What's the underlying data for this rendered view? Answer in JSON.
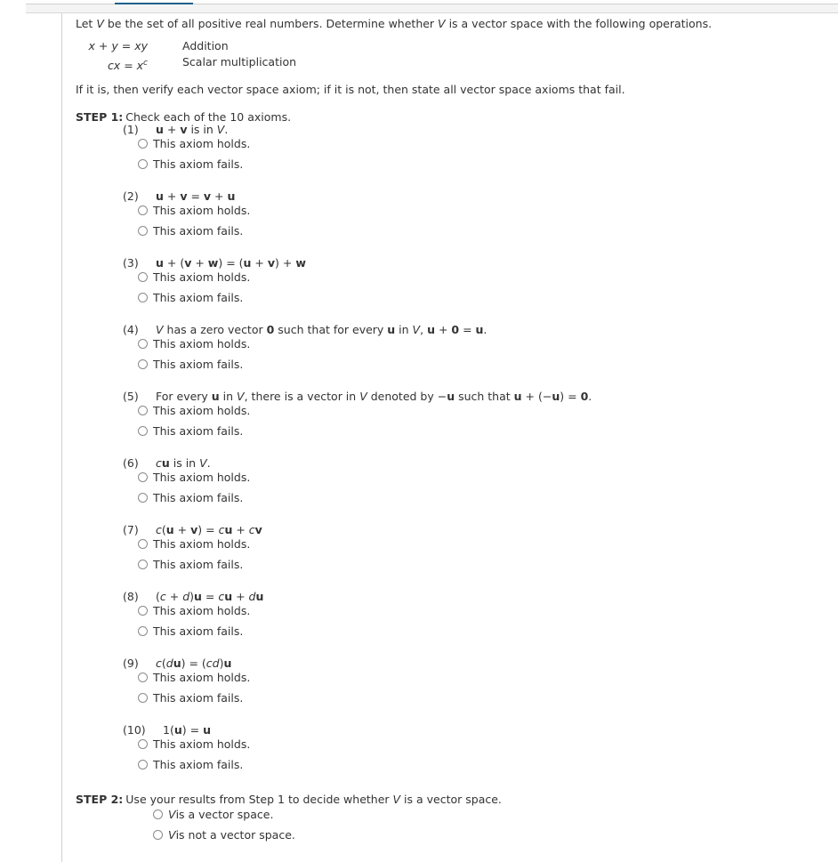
{
  "problem": {
    "intro_parts": [
      "Let ",
      "V",
      " be the set of all positive real numbers. Determine whether ",
      "V",
      " is a vector space with the following operations."
    ],
    "operations": [
      {
        "lhs_a": "x",
        "op": " + ",
        "lhs_b": "y",
        "eq": " = ",
        "rhs": "xy",
        "label": "Addition"
      },
      {
        "lhs_a": "cx",
        "eq": " = ",
        "rhs_base": "x",
        "rhs_sup": "c",
        "label": "Scalar multiplication"
      }
    ],
    "instruction": "If it is, then verify each vector space axiom; if it is not, then state all vector space axioms that fail."
  },
  "step1": {
    "label": "STEP 1:",
    "text": "Check each of the 10 axioms.",
    "axioms": [
      {
        "num": "(1)",
        "statement_html": "<b>u</b> + <b>v</b> is in <i>V</i>."
      },
      {
        "num": "(2)",
        "statement_html": "<b>u</b> + <b>v</b> = <b>v</b> + <b>u</b>"
      },
      {
        "num": "(3)",
        "statement_html": "<b>u</b> + (<b>v</b> + <b>w</b>) = (<b>u</b> + <b>v</b>) + <b>w</b>"
      },
      {
        "num": "(4)",
        "statement_html": "<i>V</i> has a zero vector <b>0</b> such that for every <b>u</b> in <i>V</i>, <b>u</b> + <b>0</b> = <b>u</b>."
      },
      {
        "num": "(5)",
        "statement_html": "For every <b>u</b> in <i>V</i>, there is a vector in <i>V</i> denoted by &minus;<b>u</b> such that <b>u</b> + (&minus;<b>u</b>) = <b>0</b>."
      },
      {
        "num": "(6)",
        "statement_html": "<i>c</i><b>u</b> is in <i>V</i>."
      },
      {
        "num": "(7)",
        "statement_html": "<i>c</i>(<b>u</b> + <b>v</b>) = <i>c</i><b>u</b> + <i>c</i><b>v</b>"
      },
      {
        "num": "(8)",
        "statement_html": "(<i>c</i> + <i>d</i>)<b>u</b> = <i>c</i><b>u</b> + <i>d</i><b>u</b>"
      },
      {
        "num": "(9)",
        "statement_html": "<i>c</i>(<i>d</i><b>u</b>) = (<i>cd</i>)<b>u</b>"
      },
      {
        "num": "(10)",
        "statement_html": "1(<b>u</b>) = <b>u</b>"
      }
    ],
    "option_holds": "This axiom holds.",
    "option_fails": "This axiom fails.",
    "selected": null
  },
  "step2": {
    "label": "STEP 2:",
    "text_parts": [
      "Use your results from Step 1 to decide whether ",
      "V",
      " is a vector space."
    ],
    "options": [
      {
        "var": "V",
        "text": " is a vector space."
      },
      {
        "var": "V",
        "text": " is not a vector space."
      }
    ],
    "selected": null
  }
}
